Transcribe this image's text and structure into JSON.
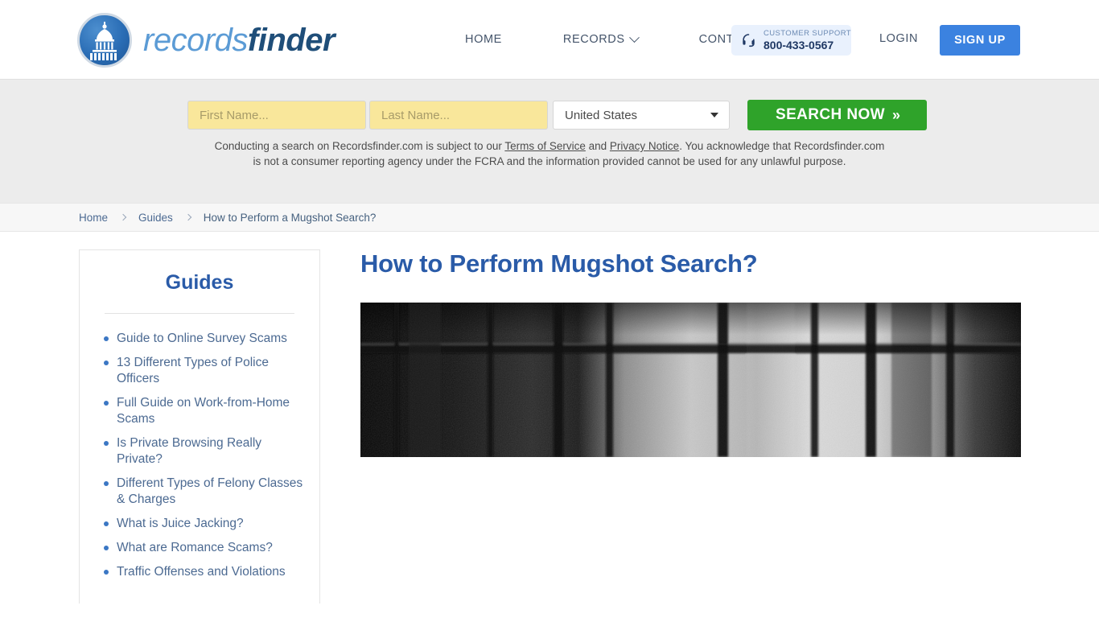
{
  "header": {
    "logo": {
      "part1": "records",
      "part2": "finder",
      "seal_icon": "capitol-dome-icon"
    },
    "nav": [
      {
        "label": "HOME",
        "has_caret": false
      },
      {
        "label": "RECORDS",
        "has_caret": true
      },
      {
        "label": "CONTACT",
        "has_caret": false
      }
    ],
    "support": {
      "icon": "headset-icon",
      "label": "CUSTOMER SUPPORT",
      "phone": "800-433-0567"
    },
    "login_label": "LOGIN",
    "signup_label": "SIGN UP",
    "accent_blue": "#3b82e0"
  },
  "search": {
    "first_name_placeholder": "First Name...",
    "first_name_value": "",
    "last_name_placeholder": "Last Name...",
    "last_name_value": "",
    "state_selected": "United States",
    "button_label": "SEARCH NOW",
    "button_chevron": "»",
    "button_color": "#2fa32a",
    "disclaimer": {
      "part1": "Conducting a search on Recordsfinder.com is subject to our ",
      "link1": "Terms of Service",
      "part2": " and ",
      "link2": "Privacy Notice",
      "part3": ". You acknowledge that Recordsfinder.com is not a consumer reporting agency under the FCRA and the information provided cannot be used for any unlawful purpose."
    }
  },
  "breadcrumb": [
    {
      "label": "Home",
      "current": false
    },
    {
      "label": "Guides",
      "current": false
    },
    {
      "label": "How to Perform a Mugshot Search?",
      "current": true
    }
  ],
  "sidebar": {
    "title": "Guides",
    "items": [
      {
        "label": "Guide to Online Survey Scams"
      },
      {
        "label": "13 Different Types of Police Officers"
      },
      {
        "label": "Full Guide on Work-from-Home Scams"
      },
      {
        "label": "Is Private Browsing Really Private?"
      },
      {
        "label": "Different Types of Felony Classes & Charges"
      },
      {
        "label": "What is Juice Jacking?"
      },
      {
        "label": "What are Romance Scams?"
      },
      {
        "label": "Traffic Offenses and Violations"
      }
    ]
  },
  "article": {
    "title": "How to Perform Mugshot Search?",
    "hero_image_alt": "barred-prison-window-image"
  }
}
